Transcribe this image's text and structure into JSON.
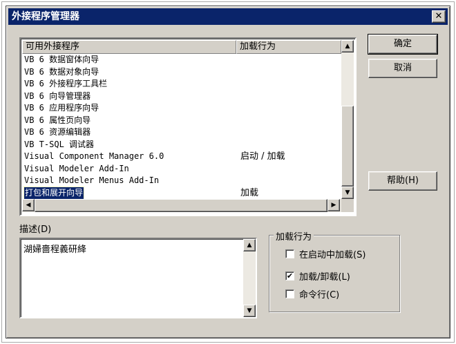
{
  "window": {
    "title": "外接程序管理器",
    "close_glyph": "✕"
  },
  "addin_list": {
    "columns": [
      "可用外接程序",
      "加载行为"
    ],
    "rows": [
      {
        "name": "VB 6 数据窗体向导",
        "behavior": ""
      },
      {
        "name": "VB 6 数据对象向导",
        "behavior": ""
      },
      {
        "name": "VB 6 外接程序工具栏",
        "behavior": ""
      },
      {
        "name": "VB 6 向导管理器",
        "behavior": ""
      },
      {
        "name": "VB 6 应用程序向导",
        "behavior": ""
      },
      {
        "name": "VB 6 属性页向导",
        "behavior": ""
      },
      {
        "name": "VB 6 资源编辑器",
        "behavior": ""
      },
      {
        "name": "VB T-SQL 调试器",
        "behavior": ""
      },
      {
        "name": "Visual Component Manager 6.0",
        "behavior": "启动 / 加载"
      },
      {
        "name": "Visual Modeler Add-In",
        "behavior": ""
      },
      {
        "name": "Visual Modeler Menus Add-In",
        "behavior": ""
      },
      {
        "name": "打包和展开向导",
        "behavior": "加载",
        "selected": true
      }
    ]
  },
  "buttons": {
    "ok": "确定",
    "cancel": "取消",
    "help": "帮助(H)"
  },
  "description": {
    "label": "描述(D)",
    "text": "湖婦嗇程義研絳"
  },
  "load_behavior": {
    "legend": "加载行为",
    "options": [
      {
        "label": "在启动中加载(S)",
        "checked": false
      },
      {
        "label": "加载/卸载(L)",
        "checked": true
      },
      {
        "label": "命令行(C)",
        "checked": false
      }
    ]
  },
  "icons": {
    "scroll_up": "▲",
    "scroll_down": "▼",
    "scroll_left": "◀",
    "scroll_right": "▶",
    "check": "✔"
  }
}
